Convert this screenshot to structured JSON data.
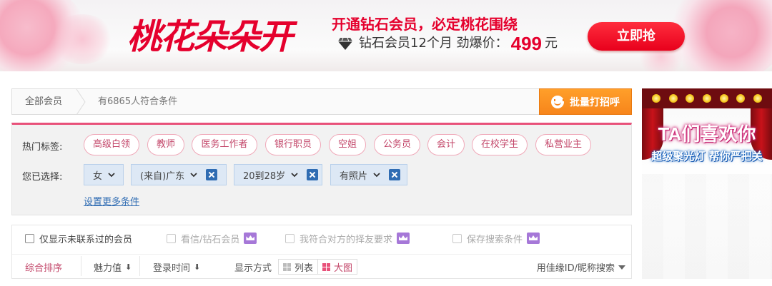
{
  "banner": {
    "brand": "桃花朵朵开",
    "slogan": "开通钻石会员，必定桃花围绕",
    "offer_text": "钻石会员12个月  劲爆价：",
    "price": "499",
    "price_unit": "元",
    "buy_label": "立即抢"
  },
  "breadcrumb": {
    "all_members": "全部会员",
    "count_text": "有6865人符合条件",
    "batch_greet_label": "批量打招呼"
  },
  "filters": {
    "hot_label": "热门标签:",
    "hot_tags": [
      "高级白领",
      "教师",
      "医务工作者",
      "银行职员",
      "空姐",
      "公务员",
      "会计",
      "在校学生",
      "私营业主"
    ],
    "selected_label": "您已选择:",
    "selected": [
      "女",
      "(来自)广东",
      "20到28岁",
      "有照片"
    ],
    "more_link": "设置更多条件"
  },
  "options": {
    "only_uncontacted": "仅显示未联系过的会员",
    "view_letters": "看信/钻石会员",
    "matches_requirements": "我符合对方的择友要求",
    "save_search": "保存搜索条件"
  },
  "sort": {
    "comprehensive": "综合排序",
    "charm": "魅力值",
    "login_time": "登录时间",
    "display_mode": "显示方式",
    "list": "列表",
    "big_image": "大图",
    "id_search": "用佳缘ID/昵称搜索"
  },
  "side_ad": {
    "headline": "TA们喜欢你",
    "subline": "超级聚光灯 帮你严把关"
  },
  "colors": {
    "brand_red": "#e5002d",
    "accent_pink": "#e8517a",
    "orange": "#f7851b",
    "chip_blue": "#2f6cb3"
  }
}
